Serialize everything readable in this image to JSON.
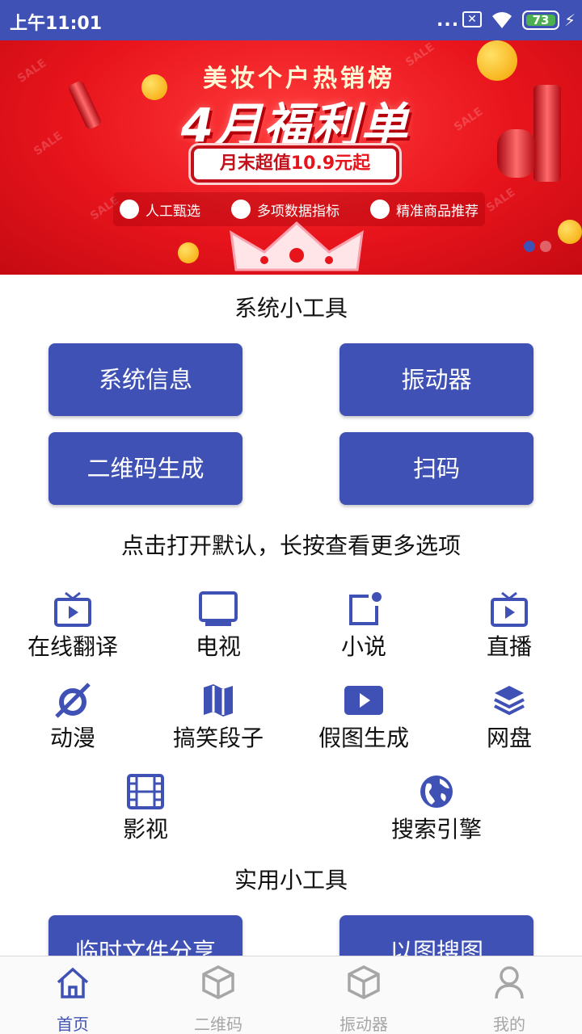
{
  "status_bar": {
    "time": "上午11:01",
    "signal_dots": "...",
    "battery_level": "73",
    "sim_icon": "x-box-icon",
    "wifi_icon": "wifi-icon",
    "charging_icon": "bolt-icon"
  },
  "banner": {
    "headline": "美妆个户热销榜",
    "main": "4月福利单",
    "pill_prefix": "月末超值",
    "pill_highlight": "10.9元起",
    "features": [
      "人工甄选",
      "多项数据指标",
      "精准商品推荐"
    ],
    "watermark": "SALE",
    "page_count": 2,
    "active_page": 0
  },
  "system_tools": {
    "title": "系统小工具",
    "buttons": [
      "系统信息",
      "振动器",
      "二维码生成",
      "扫码"
    ]
  },
  "hint": "点击打开默认，长按查看更多选项",
  "tools": [
    {
      "label": "在线翻译",
      "icon": "tv-play-icon"
    },
    {
      "label": "电视",
      "icon": "monitor-icon"
    },
    {
      "label": "小说",
      "icon": "notification-square-icon"
    },
    {
      "label": "直播",
      "icon": "tv-play-icon"
    },
    {
      "label": "动漫",
      "icon": "orbit-icon"
    },
    {
      "label": "搞笑段子",
      "icon": "map-icon"
    },
    {
      "label": "假图生成",
      "icon": "video-play-icon"
    },
    {
      "label": "网盘",
      "icon": "layers-icon"
    },
    {
      "label": "影视",
      "icon": "film-icon"
    },
    {
      "label": "搜索引擎",
      "icon": "globe-icon"
    }
  ],
  "practical_tools": {
    "title": "实用小工具",
    "buttons": [
      "临时文件分享",
      "以图搜图"
    ]
  },
  "bottom_nav": [
    {
      "label": "首页",
      "icon": "home-icon",
      "active": true
    },
    {
      "label": "二维码",
      "icon": "cube-icon",
      "active": false
    },
    {
      "label": "振动器",
      "icon": "cube-icon",
      "active": false
    },
    {
      "label": "我的",
      "icon": "person-icon",
      "active": false
    }
  ],
  "colors": {
    "primary": "#3f51b5",
    "banner_red": "#e8141c",
    "inactive": "#a6a6a6"
  }
}
